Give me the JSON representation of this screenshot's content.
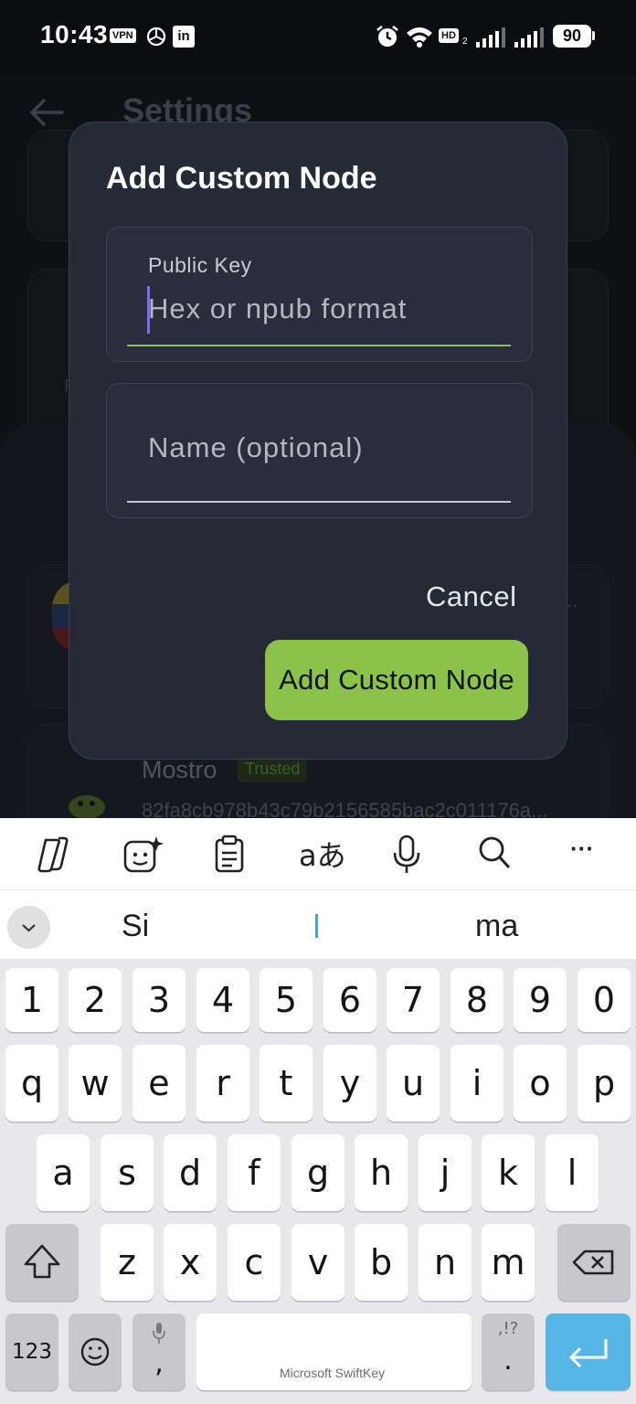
{
  "status_bar": {
    "time": "10:43",
    "vpn_badge": "VPN",
    "linkedin_badge": "in",
    "hd_badge": "HD",
    "hd_sub": "2",
    "battery": "90"
  },
  "background": {
    "screen_title": "Settings",
    "node_name": "Mostro",
    "node_badge": "Trusted",
    "node_pubkey": "82fa8cb978b43c79b2156585bac2c011176a...",
    "more_marker": "...",
    "fragment_r": "R"
  },
  "dialog": {
    "title": "Add Custom Node",
    "public_key": {
      "label": "Public Key",
      "placeholder": "Hex or npub format",
      "value": ""
    },
    "name": {
      "placeholder": "Name (optional)",
      "value": ""
    },
    "cancel_label": "Cancel",
    "confirm_label": "Add Custom Node",
    "accent": "#8bc34a"
  },
  "keyboard": {
    "toolbar_icons": [
      "copilot-icon",
      "sticker-icon",
      "clipboard-icon",
      "translate-icon",
      "microphone-icon",
      "search-icon",
      "more-icon"
    ],
    "translate_glyph": "aあ",
    "more_glyph": "···",
    "suggestions": [
      "Si",
      "",
      "ma"
    ],
    "number_row": [
      "1",
      "2",
      "3",
      "4",
      "5",
      "6",
      "7",
      "8",
      "9",
      "0"
    ],
    "row1": [
      "q",
      "w",
      "e",
      "r",
      "t",
      "y",
      "u",
      "i",
      "o",
      "p"
    ],
    "row2": [
      "a",
      "s",
      "d",
      "f",
      "g",
      "h",
      "j",
      "k",
      "l"
    ],
    "row3": [
      "z",
      "x",
      "c",
      "v",
      "b",
      "n",
      "m"
    ],
    "numbers_key": "123",
    "comma_key": ",",
    "punct_key_top": ",!?",
    "punct_key_bottom": ".",
    "brand": "Microsoft SwiftKey"
  }
}
